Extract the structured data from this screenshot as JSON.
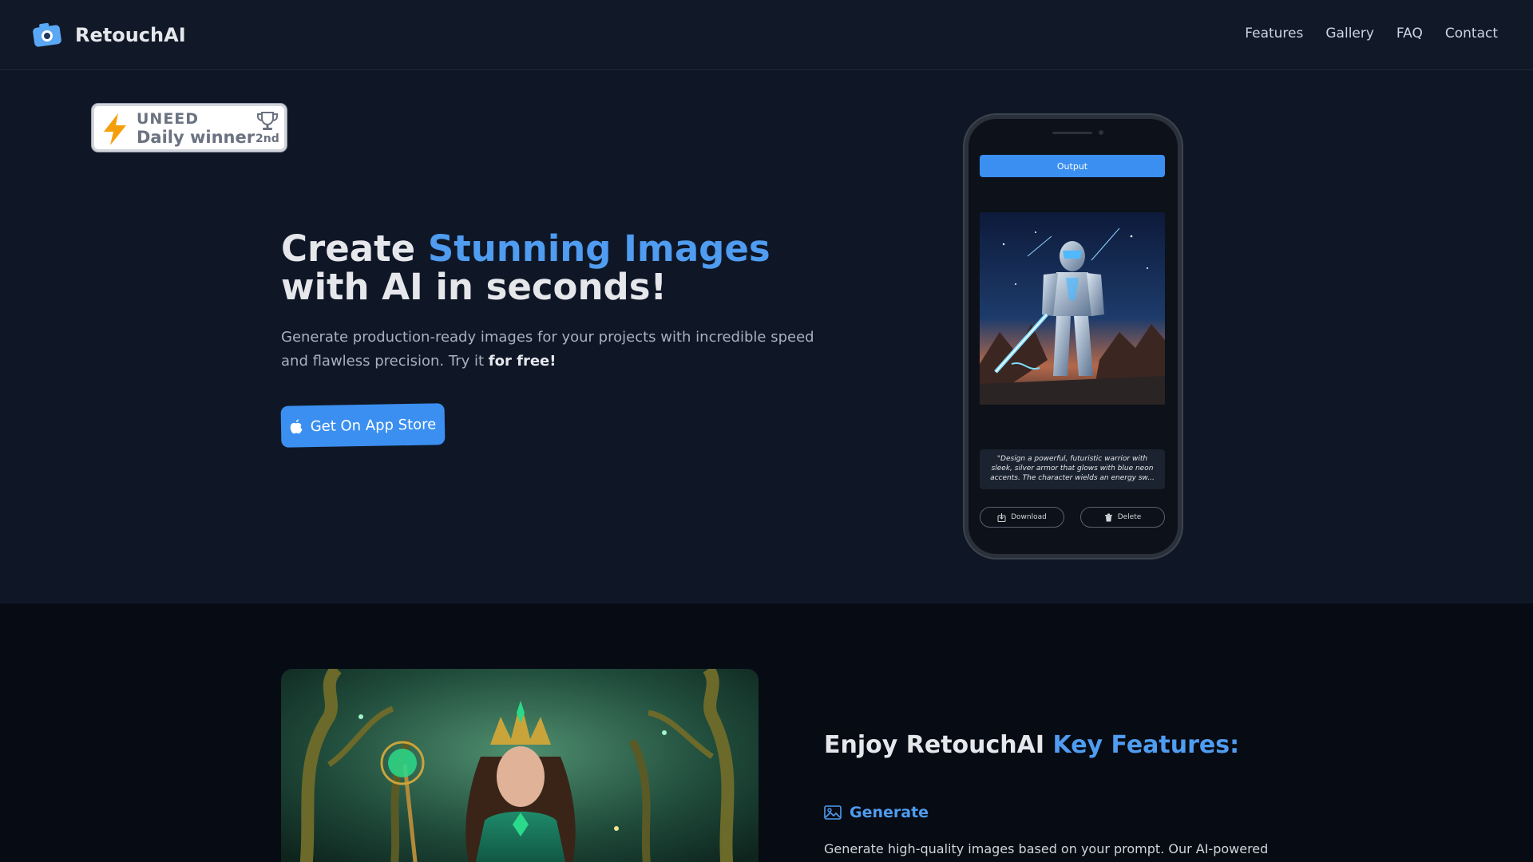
{
  "nav": {
    "brand": "RetouchAI",
    "links": [
      "Features",
      "Gallery",
      "FAQ",
      "Contact"
    ]
  },
  "badge": {
    "brand": "UNEED",
    "title": "Daily winner",
    "rank": "2nd",
    "icons": [
      "lightning-icon",
      "trophy-icon"
    ]
  },
  "hero": {
    "title_pre": "Create ",
    "title_accent": "Stunning Images",
    "title_post": " with AI in seconds!",
    "subtitle": "Generate production-ready images for your projects with incredible speed and flawless precision. Try it ",
    "subtitle_bold": "for free!",
    "cta_label": "Get On App Store"
  },
  "phone": {
    "tab_label": "Output",
    "prompt": "\"Design a powerful, futuristic warrior with sleek, silver armor that glows with blue neon accents. The character wields an energy sw...",
    "download_label": "Download",
    "delete_label": "Delete"
  },
  "features": {
    "title_pre": "Enjoy RetouchAI ",
    "title_accent": "Key Features:",
    "items": [
      {
        "name": "Generate",
        "icon": "image-icon",
        "description": "Generate high-quality images based on your prompt. Our AI-powered"
      }
    ]
  },
  "colors": {
    "accent": "#4f9cf0",
    "button": "#3b8ff0",
    "hero_bg": "#0f1727",
    "features_bg": "#070b13"
  }
}
